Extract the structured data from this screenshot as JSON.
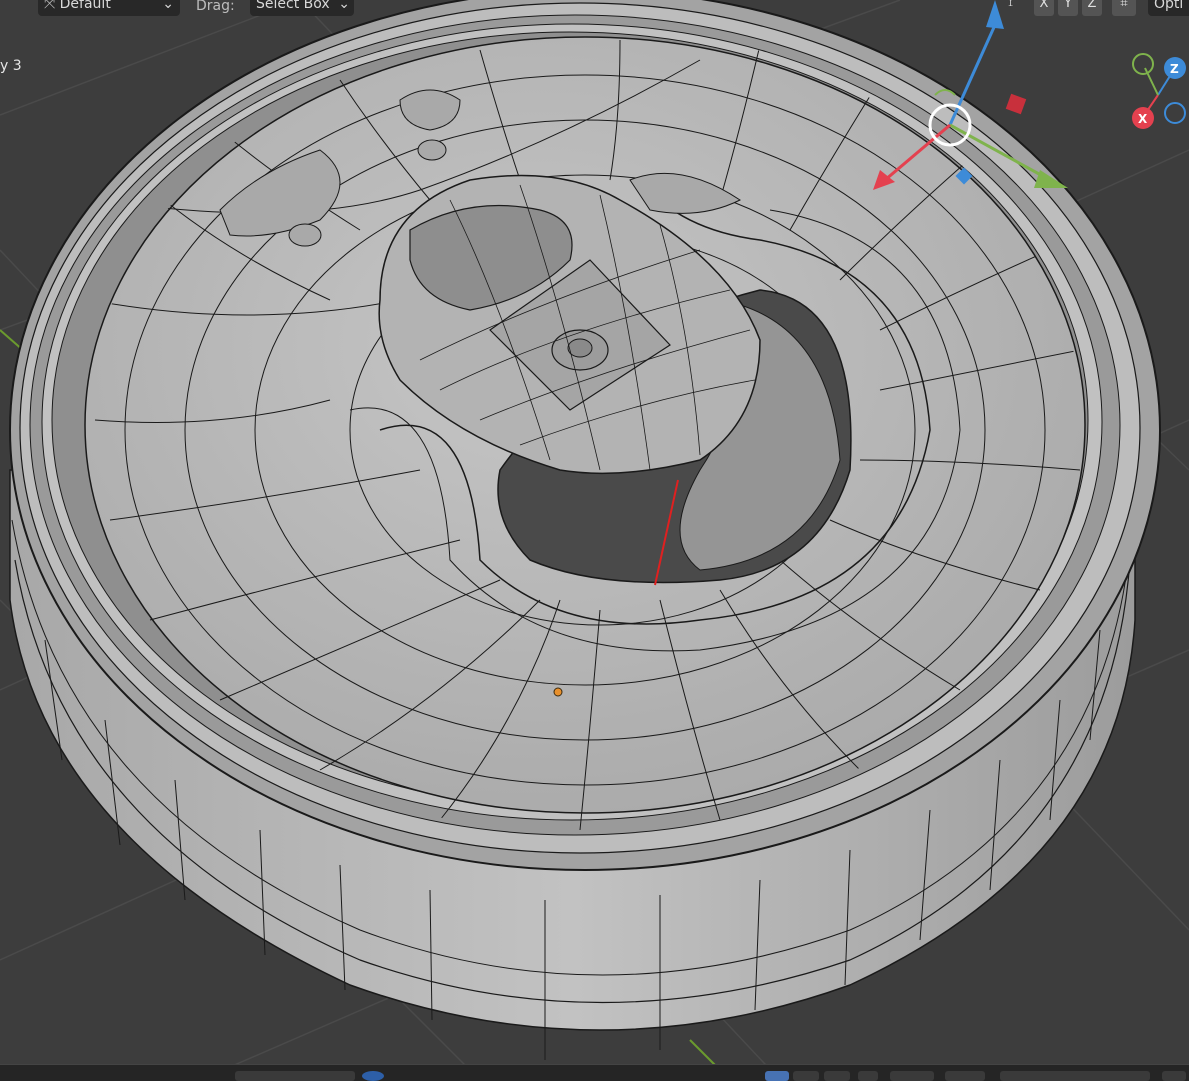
{
  "header": {
    "orientation_label": "Default",
    "drag_label": "Drag:",
    "drag_value": "Select Box",
    "axes": [
      "X",
      "Y",
      "Z"
    ],
    "options_label": "Opti"
  },
  "viewport": {
    "object_info": "y 3"
  },
  "gizmo": {
    "x_label": "X",
    "y_label": "",
    "z_label": "Z"
  },
  "colors": {
    "background": "#3d3d3d",
    "mesh": "#b9b9b9",
    "wire": "#1a1a1a",
    "axis_x": "#e4414f",
    "axis_y": "#7fb34c",
    "axis_z": "#3d8bd8"
  },
  "icons": [
    "transform-orientation-icon",
    "mirror-axis-icon",
    "snap-icon",
    "navigation-gizmo",
    "transform-gizmo"
  ]
}
